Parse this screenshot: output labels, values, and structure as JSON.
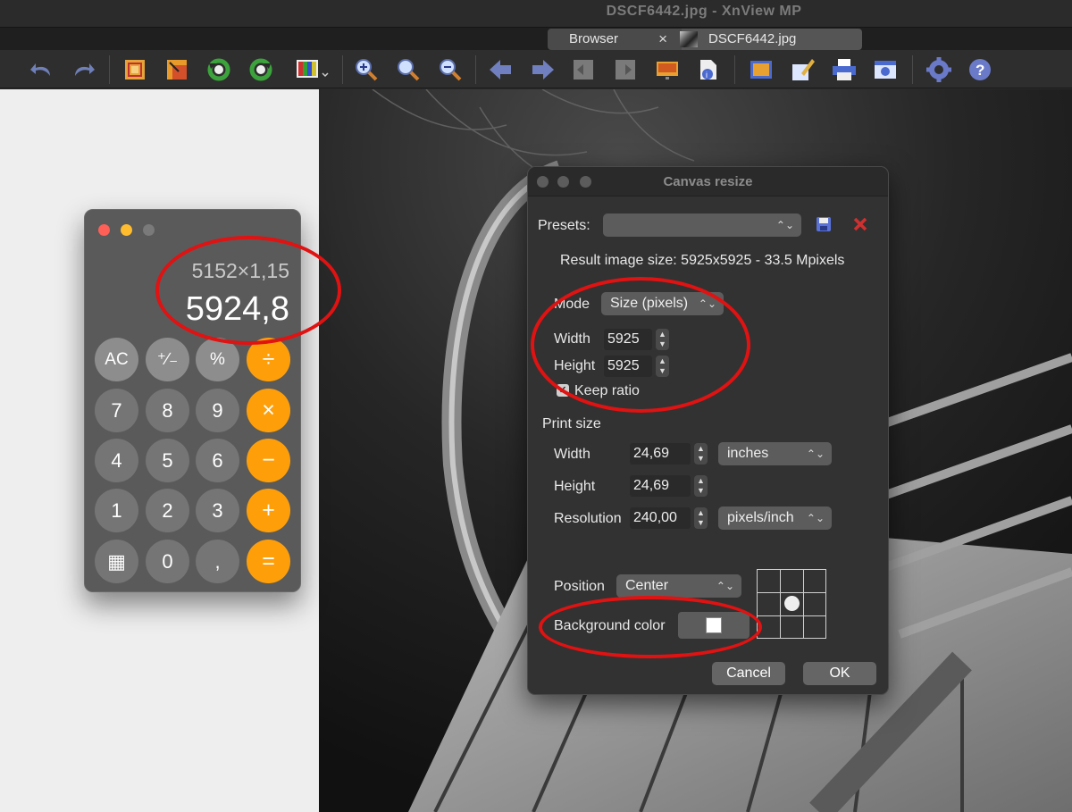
{
  "window": {
    "title": "DSCF6442.jpg - XnView MP"
  },
  "tabs": [
    {
      "label": "Browser",
      "close": "×"
    },
    {
      "label": "DSCF6442.jpg"
    }
  ],
  "toolbar": {
    "icons": [
      "undo-icon",
      "redo-icon",
      "crop-icon",
      "resize-icon",
      "rotate-left-icon",
      "rotate-right-icon",
      "color-adjust-icon",
      "zoom-in-icon",
      "zoom-fit-icon",
      "zoom-out-icon",
      "previous-icon",
      "next-icon",
      "previous-page-icon",
      "next-page-icon",
      "slideshow-icon",
      "info-icon",
      "fullscreen-icon",
      "edit-icon",
      "print-icon",
      "capture-icon",
      "settings-icon",
      "help-icon"
    ]
  },
  "calculator": {
    "expression": "5152×1,15",
    "result": "5924,8",
    "buttons": [
      [
        "AC",
        "⁺∕₋",
        "%",
        "÷"
      ],
      [
        "7",
        "8",
        "9",
        "×"
      ],
      [
        "4",
        "5",
        "6",
        "−"
      ],
      [
        "1",
        "2",
        "3",
        "+"
      ],
      [
        "▦",
        "0",
        ",",
        "="
      ]
    ]
  },
  "dialog": {
    "title": "Canvas resize",
    "presets_label": "Presets:",
    "presets_value": "",
    "result_text": "Result image size: 5925x5925 - 33.5 Mpixels",
    "mode_label": "Mode",
    "mode_value": "Size (pixels)",
    "width_label": "Width",
    "width_value": "5925",
    "height_label": "Height",
    "height_value": "5925",
    "keep_ratio_label": "Keep ratio",
    "keep_ratio_checked": true,
    "print_size_label": "Print size",
    "print_width_label": "Width",
    "print_width_value": "24,69",
    "print_unit": "inches",
    "print_height_label": "Height",
    "print_height_value": "24,69",
    "resolution_label": "Resolution",
    "resolution_value": "240,00",
    "resolution_unit": "pixels/inch",
    "position_label": "Position",
    "position_value": "Center",
    "background_label": "Background color",
    "background_color": "#ffffff",
    "cancel_label": "Cancel",
    "ok_label": "OK"
  },
  "colors": {
    "annotation": "#e01212",
    "calc_operator": "#fe9f0a"
  }
}
